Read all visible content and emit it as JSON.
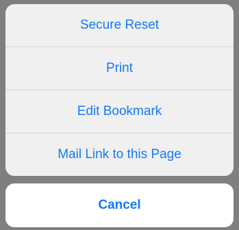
{
  "action_sheet": {
    "actions": [
      {
        "label": "Secure Reset"
      },
      {
        "label": "Print"
      },
      {
        "label": "Edit Bookmark"
      },
      {
        "label": "Mail Link to this Page"
      }
    ],
    "cancel_label": "Cancel"
  },
  "colors": {
    "accent": "#1479f5",
    "backdrop": "#7f7f7f",
    "group_background": "#f0f0f0",
    "cancel_background": "#ffffff",
    "separator": "#d4d4d4"
  }
}
